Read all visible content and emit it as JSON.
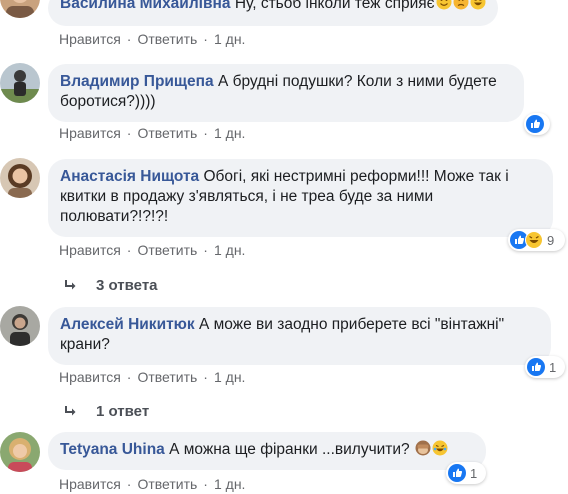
{
  "comments": [
    {
      "author": "Василина Михайлівна",
      "text": "Ну, стьоб інколи теж сприяє",
      "actions": {
        "like": "Нравится",
        "reply": "Ответить",
        "time": "1 дн."
      }
    },
    {
      "author": "Владимир Прищепа",
      "text": "А брудні подушки? Коли з ними будете боротися?))))",
      "actions": {
        "like": "Нравится",
        "reply": "Ответить",
        "time": "1 дн."
      },
      "reaction_count": ""
    },
    {
      "author": "Анастасія Нищота",
      "text": "Обогі, які нестримні реформи!!! Може так і квитки в продажу з'являться, і не треа буде за ними полювати?!?!?!",
      "actions": {
        "like": "Нравится",
        "reply": "Ответить",
        "time": "1 дн."
      },
      "reaction_count": "9",
      "replies": "3 ответа"
    },
    {
      "author": "Алексей Никитюк",
      "text": "А може ви заодно приберете всі \"вінтажні\" крани?",
      "actions": {
        "like": "Нравится",
        "reply": "Ответить",
        "time": "1 дн."
      },
      "reaction_count": "1",
      "replies": "1 ответ"
    },
    {
      "author": "Tetyana Uhina",
      "text": "А можна ще фіранки ...вилучити?",
      "actions": {
        "like": "Нравится",
        "reply": "Ответить",
        "time": "1 дн."
      },
      "reaction_count": "1"
    }
  ],
  "colors": {
    "author": "#385898",
    "bubble": "#f0f2f5",
    "meta": "#65676b",
    "like": "#1877f2"
  }
}
